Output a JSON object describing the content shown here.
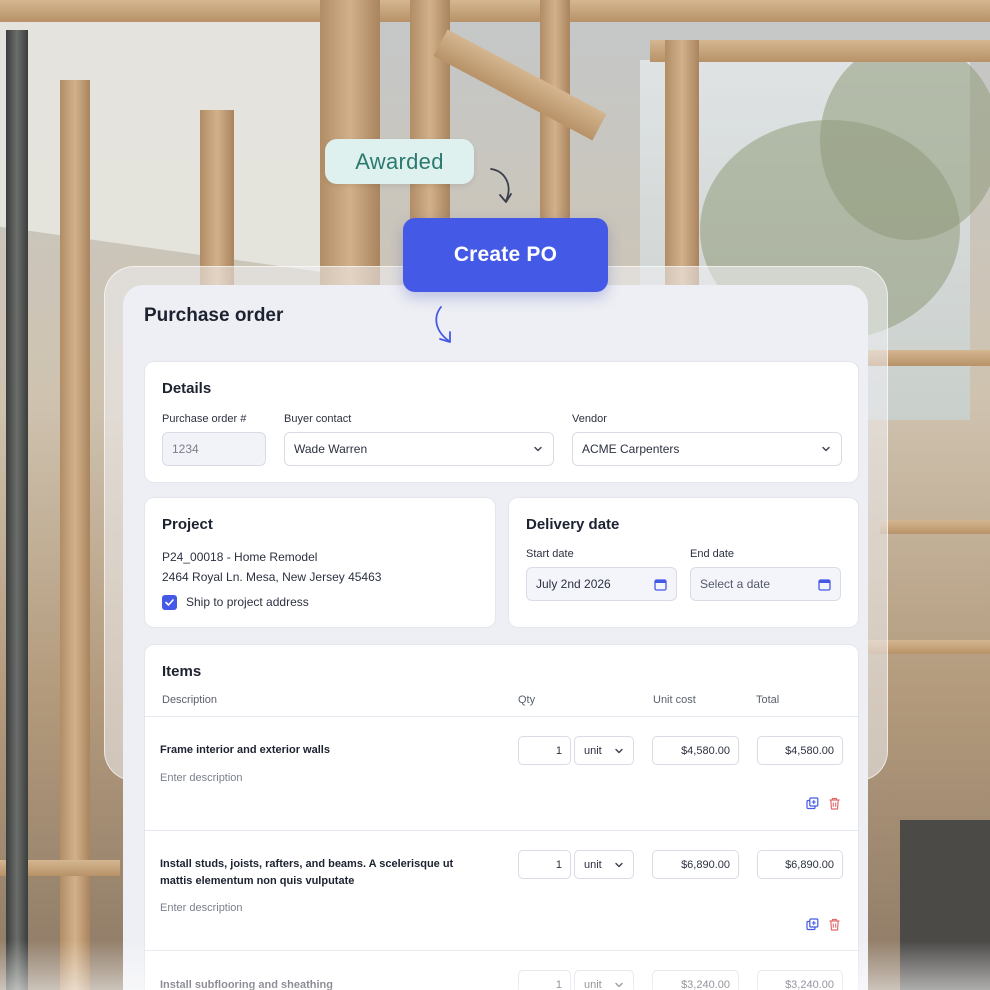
{
  "flow": {
    "awarded_label": "Awarded",
    "create_po_label": "Create PO"
  },
  "panel": {
    "title": "Purchase order"
  },
  "details": {
    "title": "Details",
    "po_number_label": "Purchase order #",
    "po_number_placeholder": "1234",
    "buyer_contact_label": "Buyer contact",
    "buyer_contact_value": "Wade Warren",
    "vendor_label": "Vendor",
    "vendor_value": "ACME Carpenters"
  },
  "project": {
    "title": "Project",
    "line1": "P24_00018 - Home Remodel",
    "line2": "2464 Royal Ln. Mesa, New Jersey 45463",
    "ship_checkbox_label": "Ship to project address",
    "ship_checked": true
  },
  "delivery": {
    "title": "Delivery date",
    "start_label": "Start date",
    "start_value": "July 2nd 2026",
    "end_label": "End date",
    "end_placeholder": "Select a date"
  },
  "items": {
    "title": "Items",
    "columns": {
      "description": "Description",
      "qty": "Qty",
      "unit_cost": "Unit cost",
      "total": "Total"
    },
    "rows": [
      {
        "description": "Frame interior and exterior walls",
        "sub_placeholder": "Enter description",
        "qty": "1",
        "unit": "unit",
        "unit_cost": "$4,580.00",
        "total": "$4,580.00"
      },
      {
        "description": "Install studs, joists, rafters, and beams. A scelerisque ut mattis elementum non quis vulputate",
        "sub_placeholder": "Enter description",
        "qty": "1",
        "unit": "unit",
        "unit_cost": "$6,890.00",
        "total": "$6,890.00"
      },
      {
        "description": "Install subflooring and sheathing",
        "qty": "1",
        "unit": "unit",
        "unit_cost": "$3,240.00",
        "total": "$3,240.00"
      }
    ]
  },
  "colors": {
    "primary": "#4459e6",
    "awarded_bg": "#dff1ef",
    "awarded_text": "#2b7a70",
    "delete_icon": "#e26b6b"
  }
}
